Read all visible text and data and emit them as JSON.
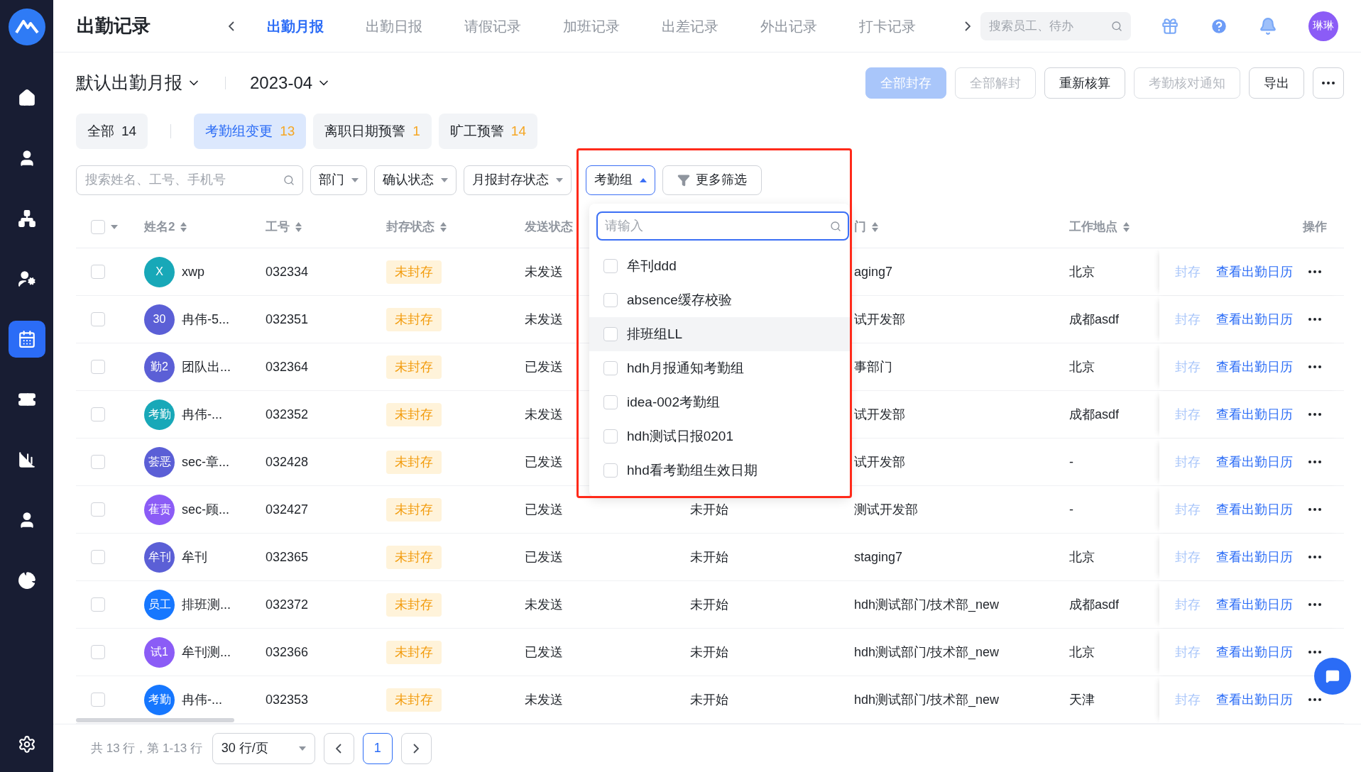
{
  "sidebar": {
    "items": [
      {
        "selected": false
      },
      {
        "selected": false
      },
      {
        "selected": false
      },
      {
        "selected": false
      },
      {
        "selected": true
      },
      {
        "selected": false
      },
      {
        "selected": false
      },
      {
        "selected": false
      },
      {
        "selected": false
      }
    ]
  },
  "header": {
    "title": "出勤记录",
    "tabs": [
      {
        "label": "出勤月报",
        "selected": true
      },
      {
        "label": "出勤日报",
        "selected": false
      },
      {
        "label": "请假记录",
        "selected": false
      },
      {
        "label": "加班记录",
        "selected": false
      },
      {
        "label": "出差记录",
        "selected": false
      },
      {
        "label": "外出记录",
        "selected": false
      },
      {
        "label": "打卡记录",
        "selected": false
      }
    ],
    "search": {
      "placeholder": "搜索员工、待办"
    },
    "avatar": "琳琳"
  },
  "report": {
    "name": "默认出勤月报",
    "month": "2023-04"
  },
  "actions": [
    {
      "label": "全部封存",
      "kind": "primary",
      "disabled": true
    },
    {
      "label": "全部解封",
      "kind": "default",
      "disabled": true
    },
    {
      "label": "重新核算",
      "kind": "default",
      "disabled": false
    },
    {
      "label": "考勤核对通知",
      "kind": "default",
      "disabled": true
    },
    {
      "label": "导出",
      "kind": "default",
      "disabled": false
    }
  ],
  "chips": [
    {
      "label": "全部",
      "count": "14",
      "selected": false,
      "color": "#1f2329"
    },
    {
      "label": "考勤组变更",
      "count": "13",
      "selected": true,
      "color": "#f5a623"
    },
    {
      "label": "离职日期预警",
      "count": "1",
      "selected": false,
      "color": "#f5a623"
    },
    {
      "label": "旷工预警",
      "count": "14",
      "selected": false,
      "color": "#f5a623"
    }
  ],
  "filters": {
    "search": {
      "placeholder": "搜索姓名、工号、手机号"
    },
    "dropdowns": [
      {
        "label": "部门",
        "open": false
      },
      {
        "label": "确认状态",
        "open": false
      },
      {
        "label": "月报封存状态",
        "open": false
      },
      {
        "label": "考勤组",
        "open": true
      }
    ],
    "more": "更多筛选"
  },
  "group_dropdown": {
    "search": {
      "placeholder": "请输入"
    },
    "options": [
      {
        "label": "牟刊ddd",
        "checked": false,
        "highlighted": false
      },
      {
        "label": "absence缓存校验",
        "checked": false,
        "highlighted": false
      },
      {
        "label": "排班组LL",
        "checked": false,
        "highlighted": true
      },
      {
        "label": "hdh月报通知考勤组",
        "checked": false,
        "highlighted": false
      },
      {
        "label": "idea-002考勤组",
        "checked": false,
        "highlighted": false
      },
      {
        "label": "hdh测试日报0201",
        "checked": false,
        "highlighted": false
      },
      {
        "label": "hhd看考勤组生效日期",
        "checked": false,
        "highlighted": false
      }
    ]
  },
  "table": {
    "select_all": {
      "checked": false
    },
    "columns": [
      {
        "label": "姓名2",
        "sortable": true
      },
      {
        "label": "工号",
        "sortable": true
      },
      {
        "label": "封存状态",
        "sortable": true
      },
      {
        "label": "发送状态",
        "sortable": false
      },
      {},
      {
        "label": "门",
        "sortable": true
      },
      {
        "label": "工作地点",
        "sortable": true
      },
      {
        "label": "操作",
        "sortable": false
      }
    ],
    "rows": [
      {
        "checked": false,
        "avatar": "X",
        "color": "#18a8b8",
        "name": "xwp",
        "id": "032334",
        "seal_status": "未封存",
        "send_status": "未发送",
        "department": "aging7",
        "location": "北京",
        "seal": "封存",
        "calendar": "查看出勤日历"
      },
      {
        "checked": false,
        "avatar": "30",
        "color": "#5b5fd6",
        "name": "冉伟-5...",
        "id": "032351",
        "seal_status": "未封存",
        "send_status": "未发送",
        "department": "试开发部",
        "location": "成都asdf",
        "seal": "封存",
        "calendar": "查看出勤日历"
      },
      {
        "checked": false,
        "avatar": "勤2",
        "color": "#5b5fd6",
        "name": "团队出...",
        "id": "032364",
        "seal_status": "未封存",
        "send_status": "已发送",
        "department": "事部门",
        "location": "北京",
        "seal": "封存",
        "calendar": "查看出勤日历"
      },
      {
        "checked": false,
        "avatar": "考勤",
        "color": "#18a8b8",
        "name": "冉伟-...",
        "id": "032352",
        "seal_status": "未封存",
        "send_status": "未发送",
        "department": "试开发部",
        "location": "成都asdf",
        "seal": "封存",
        "calendar": "查看出勤日历"
      },
      {
        "checked": false,
        "avatar": "荟恶",
        "color": "#5b5fd6",
        "name": "sec-章...",
        "id": "032428",
        "seal_status": "未封存",
        "send_status": "已发送",
        "department": "试开发部",
        "location": "-",
        "seal": "封存",
        "calendar": "查看出勤日历"
      },
      {
        "checked": false,
        "avatar": "萑责",
        "color": "#8b5cf6",
        "name": "sec-顾...",
        "id": "032427",
        "seal_status": "未封存",
        "send_status": "已发送",
        "column_5": "未开始",
        "department": "测试开发部",
        "location": "-",
        "seal": "封存",
        "calendar": "查看出勤日历"
      },
      {
        "checked": false,
        "avatar": "牟刊",
        "color": "#5b5fd6",
        "name": "牟刊",
        "id": "032365",
        "seal_status": "未封存",
        "send_status": "已发送",
        "column_5": "未开始",
        "department": "staging7",
        "location": "北京",
        "seal": "封存",
        "calendar": "查看出勤日历"
      },
      {
        "checked": false,
        "avatar": "员工",
        "color": "#1677ff",
        "name": "排班测...",
        "id": "032372",
        "seal_status": "未封存",
        "send_status": "未发送",
        "column_5": "未开始",
        "department": "hdh测试部门/技术部_new",
        "location": "成都asdf",
        "seal": "封存",
        "calendar": "查看出勤日历"
      },
      {
        "checked": false,
        "avatar": "试1",
        "color": "#8b5cf6",
        "name": "牟刊测...",
        "id": "032366",
        "seal_status": "未封存",
        "send_status": "已发送",
        "column_5": "未开始",
        "department": "hdh测试部门/技术部_new",
        "location": "北京",
        "seal": "封存",
        "calendar": "查看出勤日历"
      },
      {
        "checked": false,
        "avatar": "考勤",
        "color": "#1677ff",
        "name": "冉伟-...",
        "id": "032353",
        "seal_status": "未封存",
        "send_status": "未发送",
        "column_5": "未开始",
        "department": "hdh测试部门/技术部_new",
        "location": "天津",
        "seal": "封存",
        "calendar": "查看出勤日历"
      }
    ]
  },
  "footer": {
    "summary": "共 13 行，第 1-13 行",
    "page_size": "30 行/页",
    "pages": [
      {
        "label": "1",
        "selected": true
      }
    ]
  }
}
